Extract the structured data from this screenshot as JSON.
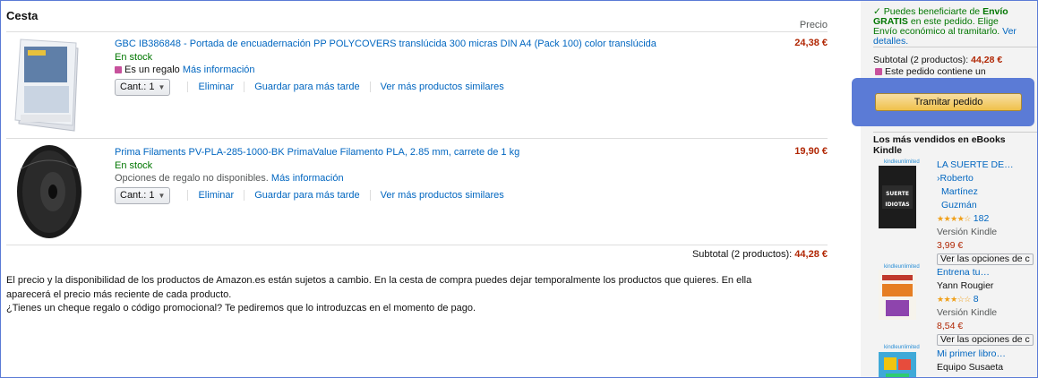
{
  "cart": {
    "title": "Cesta",
    "price_header": "Precio",
    "items": [
      {
        "title": "GBC IB386848 - Portada de encuadernación PP POLYCOVERS translúcida 300 micras DIN A4 (Pack 100) color translúcida",
        "stock": "En stock",
        "gift_text": "Es un regalo",
        "gift_link": "Más información",
        "qty_label": "Cant.:",
        "qty_value": "1",
        "delete": "Eliminar",
        "save_later": "Guardar para más tarde",
        "similar": "Ver más productos similares",
        "price": "24,38 €"
      },
      {
        "title": "Prima Filaments PV-PLA-285-1000-BK PrimaValue Filamento PLA, 2.85 mm, carrete de 1 kg",
        "stock": "En stock",
        "gift_text": "Opciones de regalo no disponibles.",
        "gift_link": "Más información",
        "qty_label": "Cant.:",
        "qty_value": "1",
        "delete": "Eliminar",
        "save_later": "Guardar para más tarde",
        "similar": "Ver más productos similares",
        "price": "19,90 €"
      }
    ],
    "subtotal_label": "Subtotal (2 productos):",
    "subtotal_value": "44,28 €",
    "note_line1": "El precio y la disponibilidad de los productos de Amazon.es están sujetos a cambio. En la cesta de compra puedes dejar temporalmente los productos que quieres. En ella",
    "note_line2": "aparecerá el precio más reciente de cada producto.",
    "note_line3": "¿Tienes un cheque regalo o código promocional? Te pediremos que lo introduzcas en el momento de pago."
  },
  "sidebar": {
    "ship_pre": "Puedes beneficiarte de",
    "ship_bold": "Envío GRATIS",
    "ship_post": "en este pedido. Elige Envío económico al tramitarlo.",
    "ship_link": "Ver detalles.",
    "subtotal_label": "Subtotal (2 productos):",
    "subtotal_value": "44,28 €",
    "gift_text": "Este pedido contiene un",
    "checkout_label": "Tramitar pedido",
    "ebooks_title": "Los más vendidos en eBooks Kindle",
    "books": [
      {
        "title": "LA SUERTE DE…",
        "author1": "›Roberto",
        "author2": "Martínez",
        "author3": "Guzmán",
        "stars": "★★★★☆",
        "rating_count": "182",
        "format": "Versión Kindle",
        "price": "3,99 €",
        "options": "Ver las opciones de c"
      },
      {
        "title": "Entrena tu…",
        "author1": "Yann Rougier",
        "stars": "★★★☆☆",
        "rating_count": "8",
        "format": "Versión Kindle",
        "price": "8,54 €",
        "options": "Ver las opciones de c"
      },
      {
        "title": "Mi primer libro…",
        "author1": "Equipo Susaeta"
      }
    ],
    "ku_label": "kindleunlimited",
    "cover1_text": "LA SUERTE DE LOS IDIOTAS"
  },
  "colors": {
    "link": "#0066c0",
    "price": "#b12704",
    "stock": "#007600",
    "focus": "#5b7bd6",
    "button": "#f0c14b"
  }
}
